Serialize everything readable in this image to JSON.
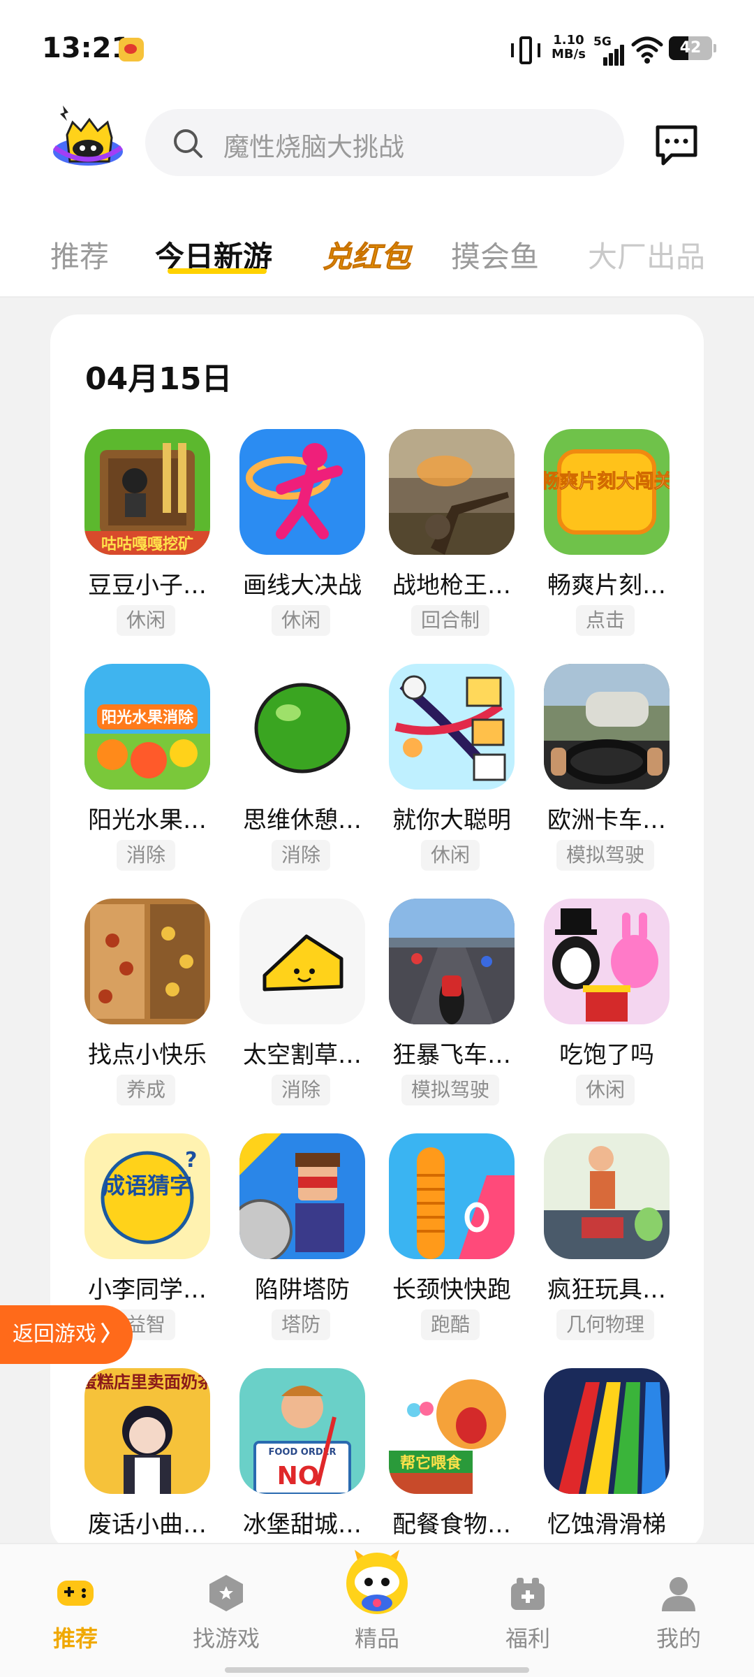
{
  "status_bar": {
    "time": "13:21",
    "net_speed_value": "1.10",
    "net_speed_unit": "MB/s",
    "network_type": "5G",
    "battery": "42"
  },
  "header": {
    "search_placeholder": "魔性烧脑大挑战"
  },
  "tabs": [
    {
      "label": "推荐"
    },
    {
      "label": "今日新游"
    },
    {
      "label": "兑红包"
    },
    {
      "label": "摸会鱼"
    },
    {
      "label": "大厂出品"
    }
  ],
  "section": {
    "date": "04月15日"
  },
  "games": [
    {
      "name": "豆豆小子…",
      "tag": "休闲"
    },
    {
      "name": "画线大决战",
      "tag": "休闲"
    },
    {
      "name": "战地枪王…",
      "tag": "回合制"
    },
    {
      "name": "畅爽片刻…",
      "tag": "点击"
    },
    {
      "name": "阳光水果…",
      "tag": "消除"
    },
    {
      "name": "思维休憩…",
      "tag": "消除"
    },
    {
      "name": "就你大聪明",
      "tag": "休闲"
    },
    {
      "name": "欧洲卡车…",
      "tag": "模拟驾驶"
    },
    {
      "name": "找点小快乐",
      "tag": "养成"
    },
    {
      "name": "太空割草…",
      "tag": "消除"
    },
    {
      "name": "狂暴飞车…",
      "tag": "模拟驾驶"
    },
    {
      "name": "吃饱了吗",
      "tag": "休闲"
    },
    {
      "name": "小李同学…",
      "tag": "益智"
    },
    {
      "name": "陷阱塔防",
      "tag": "塔防"
    },
    {
      "name": "长颈快快跑",
      "tag": "跑酷"
    },
    {
      "name": "疯狂玩具…",
      "tag": "几何物理"
    },
    {
      "name": "废话小曲…",
      "tag": ""
    },
    {
      "name": "冰堡甜城…",
      "tag": ""
    },
    {
      "name": "配餐食物…",
      "tag": ""
    },
    {
      "name": "忆蚀滑滑梯",
      "tag": ""
    }
  ],
  "icon_art": {
    "g1_caption": "咕咕嘎嘎挖矿",
    "g4_caption": "畅爽片刻大闯关",
    "g5_caption": "阳光水果消除",
    "g13_caption": "成语猜字",
    "g17_chars": "蛋糕店里卖面奶茶",
    "g18_sign": "FOOD ORDER",
    "g18_no": "NO",
    "g19_caption": "帮它喂食"
  },
  "float_button": {
    "label": "返回游戏"
  },
  "bottom_nav": [
    {
      "label": "推荐"
    },
    {
      "label": "找游戏"
    },
    {
      "label": "精品"
    },
    {
      "label": "福利"
    },
    {
      "label": "我的"
    }
  ],
  "colors": {
    "accent": "#FFD200",
    "active_nav": "#F0A800",
    "float_button": "#FF6A1A"
  }
}
